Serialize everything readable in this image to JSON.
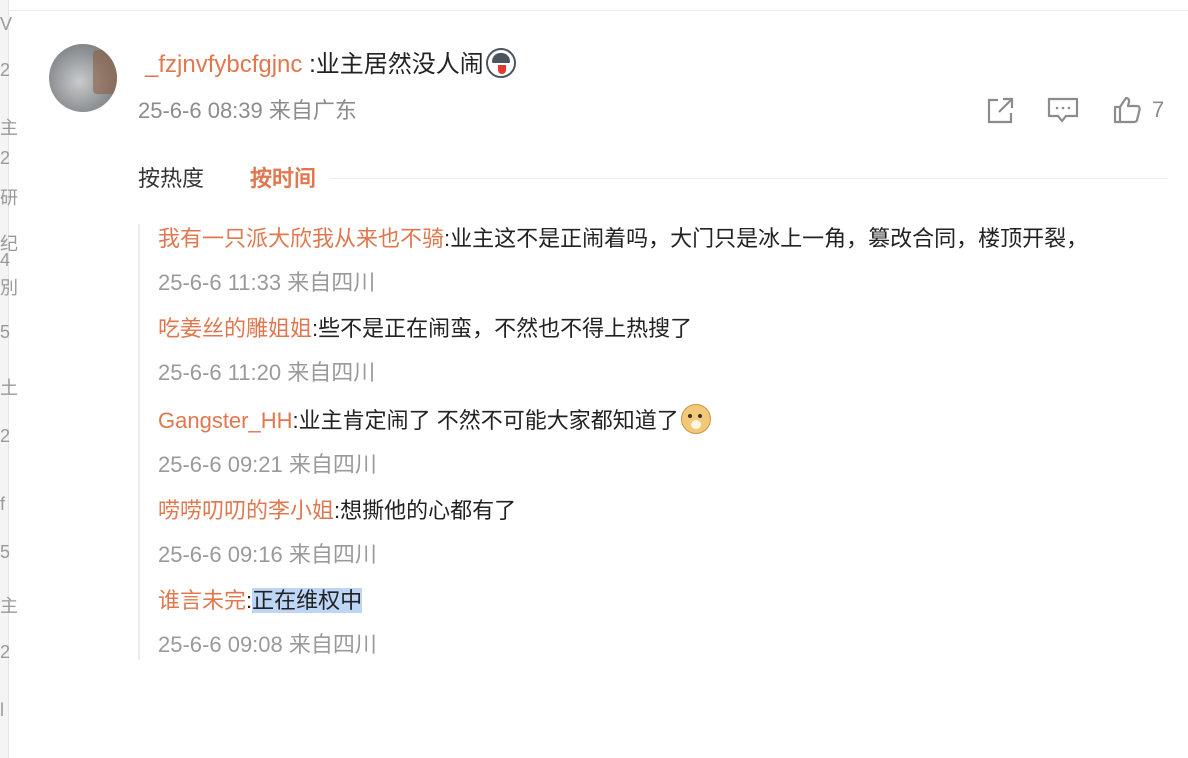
{
  "left_strip": {
    "chars": [
      "V",
      "2",
      "主",
      "2",
      "研",
      "纪",
      "4",
      "別",
      "5",
      "土",
      "2",
      "f",
      "5",
      "主",
      "2",
      "l"
    ]
  },
  "main_comment": {
    "username": "_fzjnvfybcfgjnc",
    "text": " :业主居然没人闹",
    "emoji": "husky-emoji",
    "date": "25-6-6 08:39",
    "location": "来自广东",
    "like_count": "7"
  },
  "actions": {
    "share_icon": "share-icon",
    "comment_icon": "comment-icon",
    "like_icon": "thumbs-up-icon"
  },
  "sort": {
    "hot_label": "按热度",
    "time_label": "按时间"
  },
  "replies": [
    {
      "username": "我有一只派大欣我从来也不骑",
      "text": ":业主这不是正闹着吗，大门只是冰上一角，篡改合同，楼顶开裂，",
      "date": "25-6-6 11:33",
      "location": "来自四川"
    },
    {
      "username": "吃姜丝的雕姐姐",
      "text": ":些不是正在闹蛮，不然也不得上热搜了",
      "date": "25-6-6 11:20",
      "location": "来自四川"
    },
    {
      "username": "Gangster_HH",
      "text": ":业主肯定闹了 不然不可能大家都知道了",
      "emoji": "doge-emoji",
      "date": "25-6-6 09:21",
      "location": "来自四川"
    },
    {
      "username": "唠唠叨叨的李小姐",
      "text": ":想撕他的心都有了",
      "date": "25-6-6 09:16",
      "location": "来自四川"
    },
    {
      "username": "谁言未完",
      "colon": ":",
      "text": "正在维权中",
      "date": "25-6-6 09:08",
      "location": "来自四川"
    }
  ],
  "colors": {
    "accent": "#e0784f",
    "meta_gray": "#8c8c8c",
    "selection": "#bed6f5"
  }
}
